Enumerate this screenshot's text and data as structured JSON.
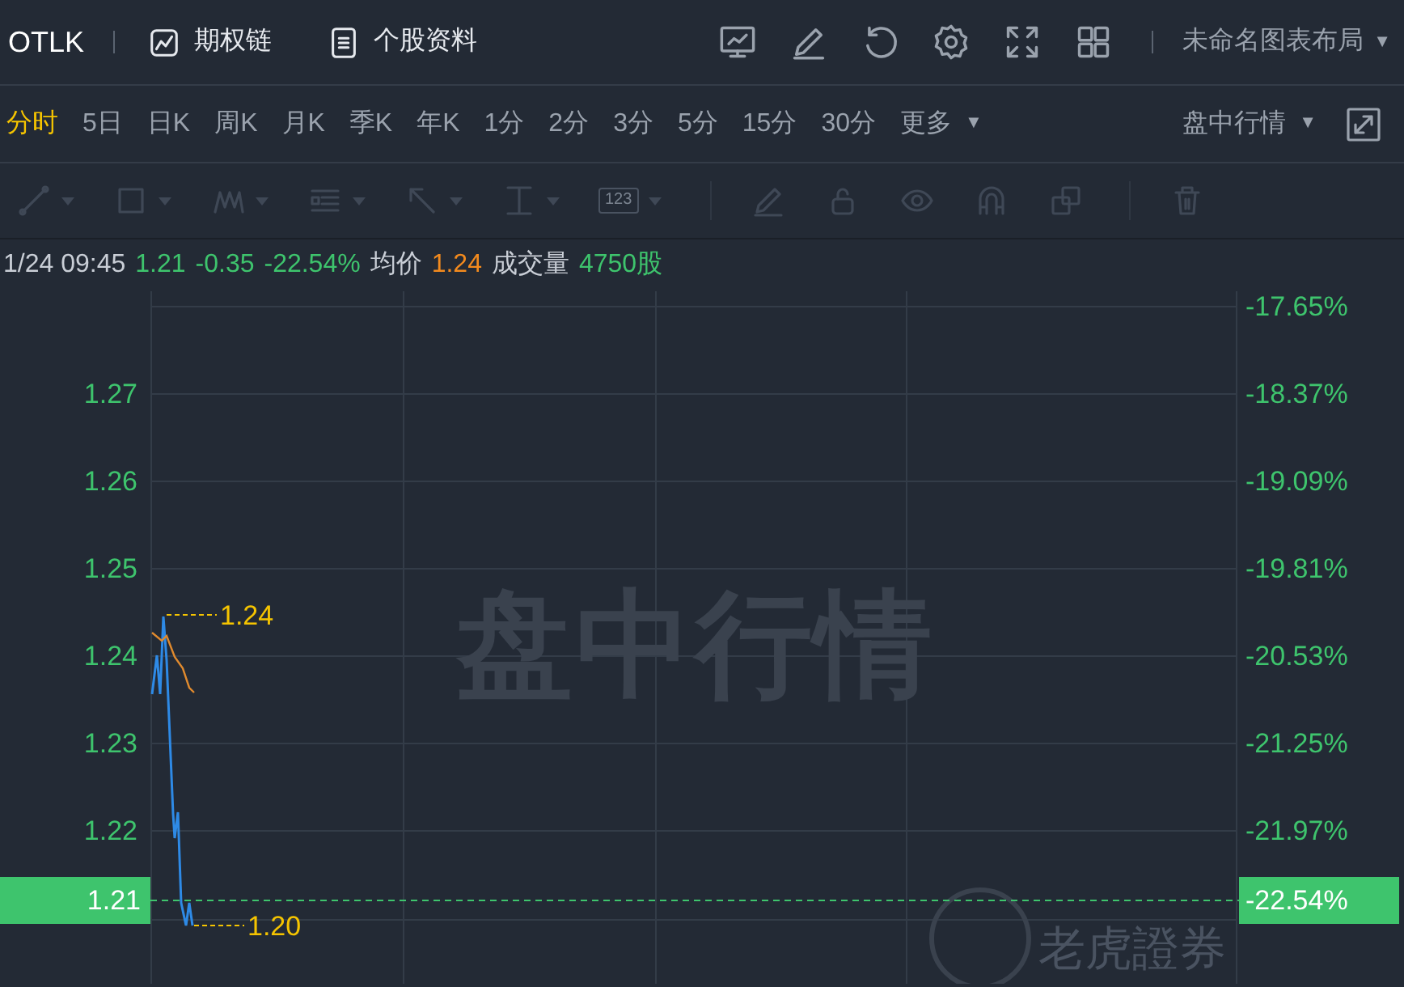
{
  "header": {
    "symbol": "OTLK",
    "links": [
      {
        "kind": "chart",
        "label": "期权链"
      },
      {
        "kind": "doc",
        "label": "个股资料"
      }
    ],
    "tools": [
      {
        "kind": "monitor"
      },
      {
        "kind": "pencil"
      },
      {
        "kind": "refresh"
      },
      {
        "kind": "gear"
      },
      {
        "kind": "expand"
      },
      {
        "kind": "grid"
      }
    ],
    "layout_menu": "未命名图表布局",
    "layout_caret": "▼"
  },
  "periods": [
    {
      "label": "分时",
      "selected": true
    },
    {
      "label": "5日",
      "selected": false
    },
    {
      "label": "日K",
      "selected": false
    },
    {
      "label": "周K",
      "selected": false
    },
    {
      "label": "月K",
      "selected": false
    },
    {
      "label": "季K",
      "selected": false
    },
    {
      "label": "年K",
      "selected": false
    },
    {
      "label": "1分",
      "selected": false
    },
    {
      "label": "2分",
      "selected": false
    },
    {
      "label": "3分",
      "selected": false
    },
    {
      "label": "5分",
      "selected": false
    },
    {
      "label": "15分",
      "selected": false
    },
    {
      "label": "30分",
      "selected": false
    }
  ],
  "more": {
    "label": "更多",
    "caret": "▼"
  },
  "session": {
    "label": "盘中行情",
    "caret": "▼"
  },
  "drawing_tools": [
    {
      "kind": "line",
      "dropdown": true
    },
    {
      "kind": "rect",
      "dropdown": true
    },
    {
      "kind": "pattern",
      "dropdown": true
    },
    {
      "kind": "lines",
      "dropdown": true
    },
    {
      "kind": "arrow",
      "dropdown": true
    },
    {
      "kind": "cursor",
      "dropdown": true
    },
    {
      "kind": "label",
      "text": "123",
      "dropdown": true
    },
    {
      "kind": "pencil",
      "dropdown": false
    },
    {
      "kind": "lock",
      "dropdown": false
    },
    {
      "kind": "eye",
      "dropdown": false
    },
    {
      "kind": "magnet",
      "dropdown": false
    },
    {
      "kind": "copy",
      "dropdown": false
    },
    {
      "kind": "trash",
      "dropdown": false
    }
  ],
  "info": [
    {
      "text": "1/24 09:45",
      "color": "#c9ced6"
    },
    {
      "text": "1.21",
      "color": "#3ec46d"
    },
    {
      "text": "-0.35",
      "color": "#3ec46d"
    },
    {
      "text": "-22.54%",
      "color": "#3ec46d"
    },
    {
      "text": "均价",
      "color": "#c9ced6"
    },
    {
      "text": "1.24",
      "color": "#f28a1e"
    },
    {
      "text": "成交量",
      "color": "#c9ced6"
    },
    {
      "text": "4750股",
      "color": "#3ec46d"
    }
  ],
  "chart": {
    "price_axis": [
      "1.27",
      "1.26",
      "1.25",
      "1.24",
      "1.23",
      "1.22"
    ],
    "percent_axis": [
      "-17.65%",
      "-18.37%",
      "-19.09%",
      "-19.81%",
      "-20.53%",
      "-21.25%",
      "-21.97%"
    ],
    "high_label": "1.24",
    "low_label": "1.20",
    "current_price": "1.21",
    "current_change": "-22.54%",
    "session_watermark": "盘中行情",
    "brand_watermark": "老虎證券"
  }
}
